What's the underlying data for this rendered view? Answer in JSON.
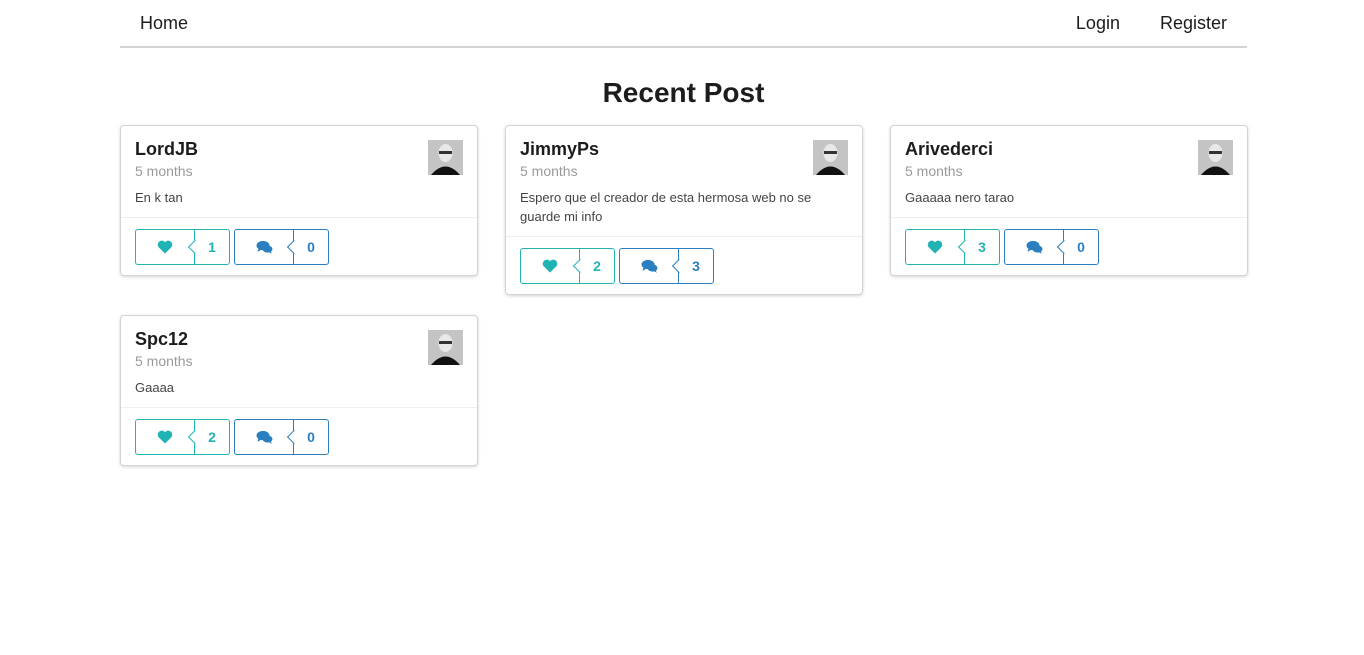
{
  "nav": {
    "home": "Home",
    "login": "Login",
    "register": "Register"
  },
  "page": {
    "title": "Recent Post"
  },
  "colors": {
    "like": "#21b3b3",
    "comment": "#2a7fc0"
  },
  "posts": [
    {
      "author": "LordJB",
      "time": "5 months",
      "text": "En k tan",
      "likes": "1",
      "comments": "0"
    },
    {
      "author": "JimmyPs",
      "time": "5 months",
      "text": "Espero que el creador de esta hermosa web no se guarde mi info",
      "likes": "2",
      "comments": "3"
    },
    {
      "author": "Arivederci",
      "time": "5 months",
      "text": "Gaaaaa nero tarao",
      "likes": "3",
      "comments": "0"
    },
    {
      "author": "Spc12",
      "time": "5 months",
      "text": "Gaaaa",
      "likes": "2",
      "comments": "0"
    }
  ],
  "icons": {
    "like": "heart-icon",
    "comment": "comments-icon",
    "avatar": "user-avatar"
  }
}
